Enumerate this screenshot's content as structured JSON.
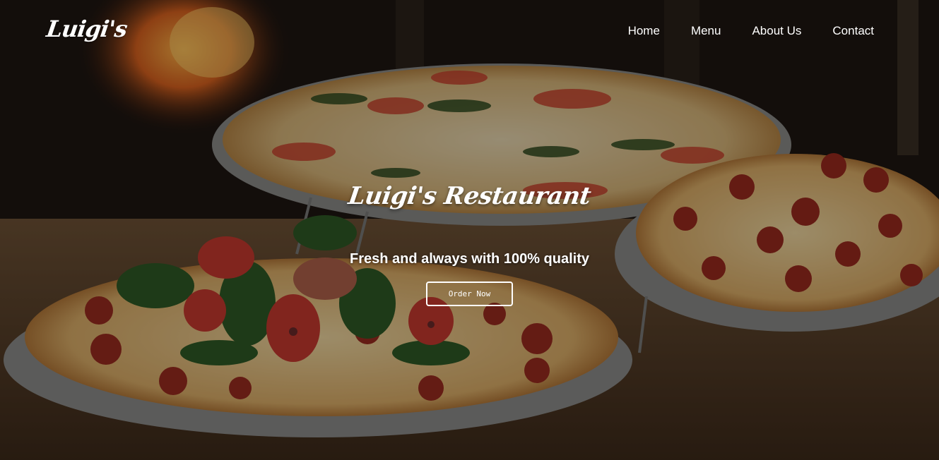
{
  "brand": {
    "logo_text": "Luigi's"
  },
  "nav": {
    "items": [
      {
        "label": "Home"
      },
      {
        "label": "Menu"
      },
      {
        "label": "About Us"
      },
      {
        "label": "Contact"
      }
    ]
  },
  "hero": {
    "title": "Luigi's Restaurant",
    "subtitle": "Fresh and always with 100% quality",
    "cta_label": "Order Now"
  },
  "colors": {
    "text": "#ffffff",
    "overlay": "rgba(0,0,0,0.35)"
  }
}
